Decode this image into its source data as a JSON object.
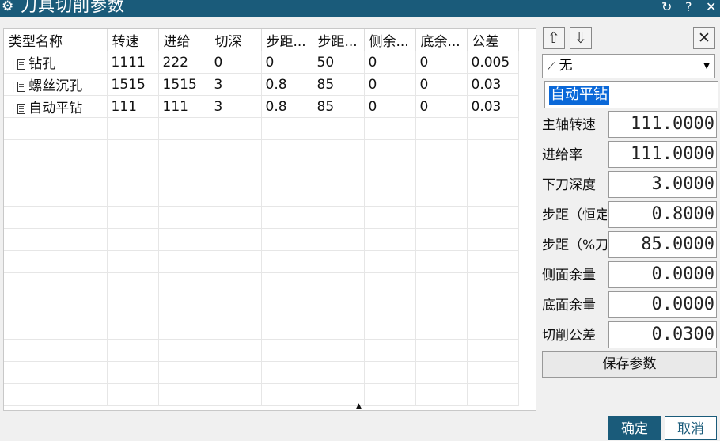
{
  "window": {
    "title": "刀具切削参数",
    "buttons": {
      "reset": "↻",
      "help": "?",
      "close": "✕"
    }
  },
  "table": {
    "columns": [
      "类型名称",
      "转速",
      "进给",
      "切深",
      "步距...",
      "步距...",
      "侧余...",
      "底余...",
      "公差"
    ],
    "rows": [
      [
        "钻孔",
        "1111",
        "222",
        "0",
        "0",
        "50",
        "0",
        "0",
        "0.005"
      ],
      [
        "螺丝沉孔",
        "1515",
        "1515",
        "3",
        "0.8",
        "85",
        "0",
        "0",
        "0.03"
      ],
      [
        "自动平钻",
        "111",
        "111",
        "3",
        "0.8",
        "85",
        "0",
        "0",
        "0.03"
      ]
    ]
  },
  "panel": {
    "move_up": "⇧",
    "move_down": "⇩",
    "delete": "✕",
    "tool_select": "无",
    "name": "自动平钻",
    "params": [
      {
        "label": "主轴转速",
        "value": "111.0000"
      },
      {
        "label": "进给率",
        "value": "111.0000"
      },
      {
        "label": "下刀深度",
        "value": "3.0000"
      },
      {
        "label": "步距（恒定）",
        "value": "0.8000"
      },
      {
        "label": "步距（%刀具）",
        "value": "85.0000"
      },
      {
        "label": "侧面余量",
        "value": "0.0000"
      },
      {
        "label": "底面余量",
        "value": "0.0000"
      },
      {
        "label": "切削公差",
        "value": "0.0300"
      }
    ],
    "save": "保存参数"
  },
  "footer": {
    "ok": "确定",
    "cancel": "取消"
  }
}
